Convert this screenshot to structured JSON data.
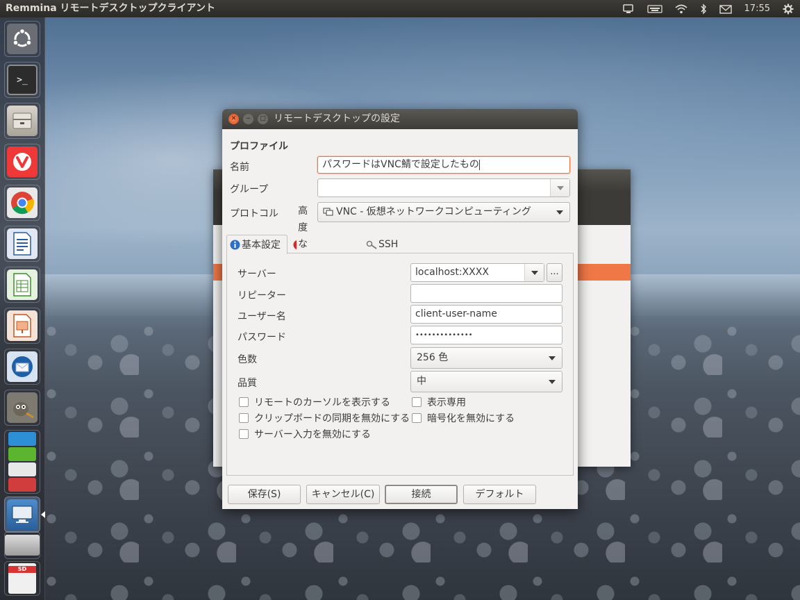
{
  "top_panel": {
    "title": "Remmina リモートデスクトップクライアント",
    "clock": "17:55"
  },
  "launcher": {
    "items": [
      "ubuntu-dash",
      "terminal",
      "files",
      "vivaldi",
      "chrome",
      "writer",
      "calc",
      "impress",
      "thunderbird",
      "gimp",
      "apps-stack",
      "remmina",
      "drive",
      "sd-card"
    ]
  },
  "dialog": {
    "title": "リモートデスクトップの設定",
    "profile_header": "プロファイル",
    "name_label": "名前",
    "name_value": "パスワードはVNC鯖で設定したもの",
    "group_label": "グループ",
    "group_value": "",
    "protocol_label": "プロトコル",
    "protocol_value": "VNC - 仮想ネットワークコンピューティング",
    "tabs": [
      {
        "label": "基本設定",
        "icon": "info-icon"
      },
      {
        "label": "高度な設定",
        "icon": "warning-icon"
      },
      {
        "label": "SSH",
        "icon": "key-icon"
      }
    ],
    "basic": {
      "server_label": "サーバー",
      "server_value": "localhost:XXXX",
      "server_more": "...",
      "repeater_label": "リピーター",
      "repeater_value": "",
      "username_label": "ユーザー名",
      "username_value": "client-user-name",
      "password_label": "パスワード",
      "password_value": "••••••••••••••",
      "colors_label": "色数",
      "colors_value": "256 色",
      "quality_label": "品質",
      "quality_value": "中",
      "checks": {
        "show_cursor": "リモートのカーソルを表示する",
        "view_only": "表示専用",
        "disable_clipboard": "クリップボードの同期を無効にする",
        "disable_encryption": "暗号化を無効にする",
        "disable_server_input": "サーバー入力を無効にする"
      }
    },
    "buttons": {
      "save": "保存(S)",
      "cancel": "キャンセル(C)",
      "connect": "接続",
      "default": "デフォルト"
    }
  }
}
